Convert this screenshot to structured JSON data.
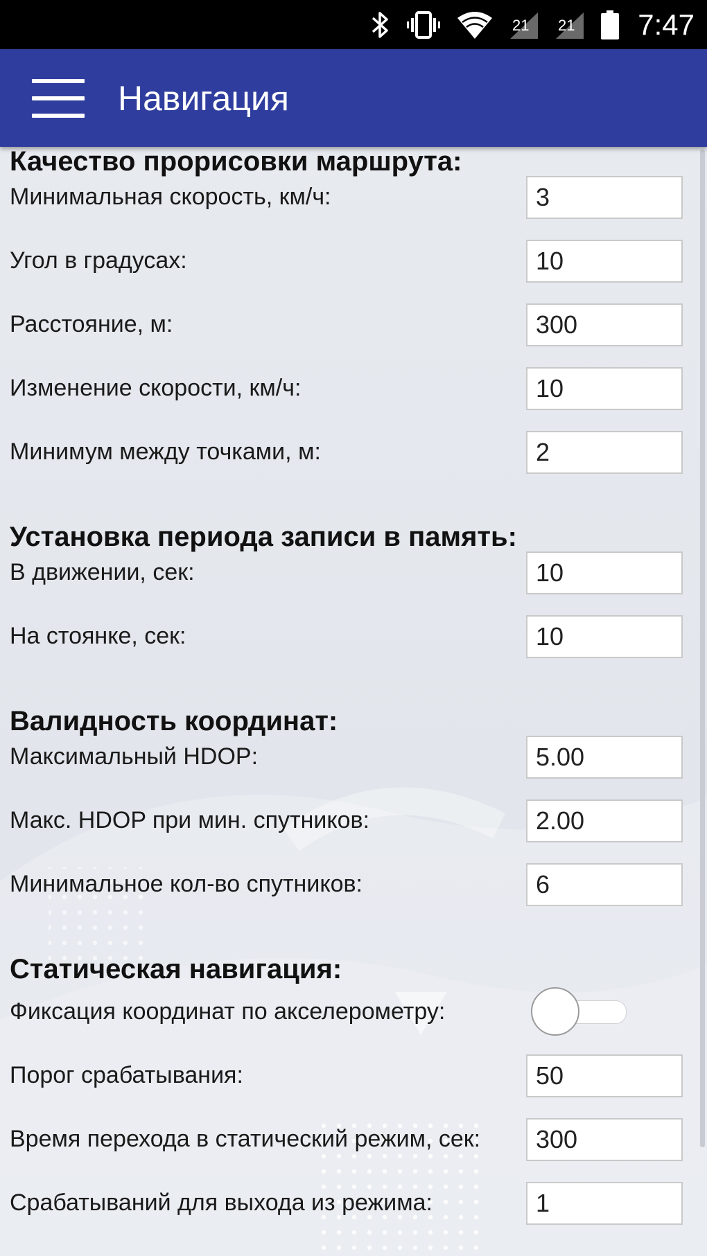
{
  "status_bar": {
    "time": "7:47",
    "icons": [
      "bluetooth-icon",
      "vibrate-icon",
      "wifi-icon",
      "signal-icon",
      "signal-icon",
      "battery-icon"
    ],
    "network_badge": "21"
  },
  "toolbar": {
    "title": "Навигация",
    "menu_icon": "hamburger-menu-icon",
    "color": "#2f3e9e"
  },
  "sections": {
    "route": {
      "title": "Качество прорисовки маршрута:",
      "fields": [
        {
          "label": "Минимальная скорость, км/ч:",
          "value": "3"
        },
        {
          "label": "Угол в градусах:",
          "value": "10"
        },
        {
          "label": "Расстояние, м:",
          "value": "300"
        },
        {
          "label": "Изменение скорости, км/ч:",
          "value": "10"
        },
        {
          "label": "Минимум между точками, м:",
          "value": "2"
        }
      ]
    },
    "period": {
      "title": "Установка периода записи в память:",
      "fields": [
        {
          "label": "В движении, сек:",
          "value": "10"
        },
        {
          "label": "На стоянке, сек:",
          "value": "10"
        }
      ]
    },
    "validity": {
      "title": "Валидность координат:",
      "fields": [
        {
          "label": "Максимальный HDOP:",
          "value": "5.00"
        },
        {
          "label": "Макс. HDOP при мин. спутников:",
          "value": "2.00"
        },
        {
          "label": "Минимальное кол-во спутников:",
          "value": "6"
        }
      ]
    },
    "static": {
      "title": "Статическая навигация:",
      "toggle": {
        "label": "Фиксация координат по акселерометру:",
        "on": false
      },
      "fields": [
        {
          "label": "Порог срабатывания:",
          "value": "50"
        },
        {
          "label": "Время перехода в статический режим, сек:",
          "value": "300"
        },
        {
          "label": "Срабатываний для выхода из режима:",
          "value": "1"
        }
      ]
    }
  }
}
